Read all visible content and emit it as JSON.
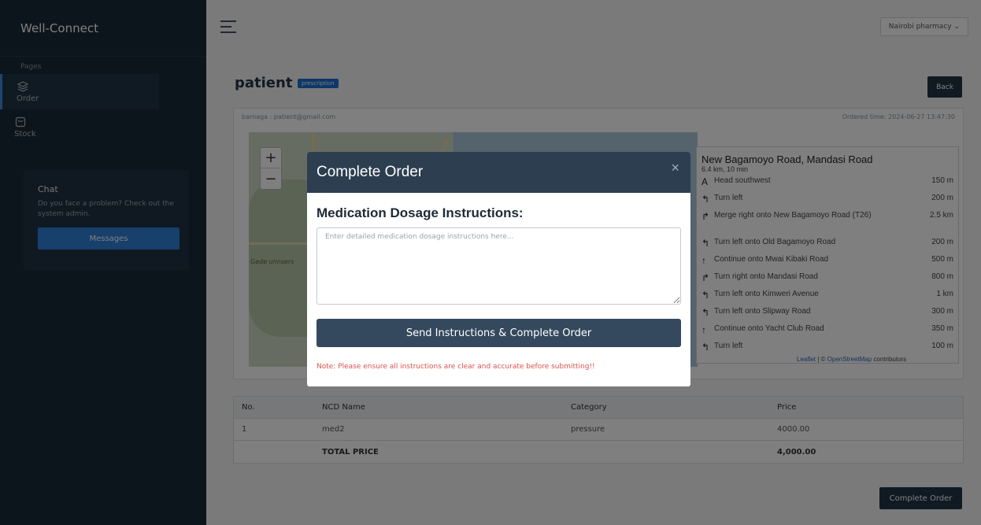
{
  "app": {
    "brand": "Well-Connect"
  },
  "sidebar": {
    "section_label": "Pages",
    "items": [
      {
        "label": "Order",
        "icon": "layers-icon",
        "active": true
      },
      {
        "label": "Stock",
        "icon": "box-icon",
        "active": false
      }
    ],
    "chat": {
      "title": "Chat",
      "text": "Do you face a problem? Check out the system admin.",
      "button_label": "Messages"
    }
  },
  "topbar": {
    "pharmacy_select": "Nairobi pharmacy ⌄"
  },
  "order": {
    "title": "patient",
    "badge": "prescription",
    "back_label": "Back",
    "user_email": "barnaga : patient@gmail.com",
    "ordered_time": "Ordered time: 2024-06-27 13:47:30"
  },
  "map": {
    "zoom_in": "+",
    "zoom_out": "−",
    "place_label": "Gede unnsers",
    "routing": {
      "title": "New Bagamoyo Road, Mandasi Road",
      "summary": "6.4 km, 10 min",
      "steps": [
        {
          "arrow": "A",
          "text": "Head southwest",
          "dist": "150 m"
        },
        {
          "arrow": "↰",
          "text": "Turn left",
          "dist": "200 m"
        },
        {
          "arrow": "↱",
          "text": "Merge right onto New Bagamoyo Road (T26)",
          "dist": "2.5 km"
        },
        {
          "arrow": "↰",
          "text": "Turn left onto Old Bagamoyo Road",
          "dist": "200 m"
        },
        {
          "arrow": "↑",
          "text": "Continue onto Mwai Kibaki Road",
          "dist": "500 m"
        },
        {
          "arrow": "↱",
          "text": "Turn right onto Mandasi Road",
          "dist": "800 m"
        },
        {
          "arrow": "↰",
          "text": "Turn left onto Kimweri Avenue",
          "dist": "1 km"
        },
        {
          "arrow": "↰",
          "text": "Turn left onto Slipway Road",
          "dist": "300 m"
        },
        {
          "arrow": "↑",
          "text": "Continue onto Yacht Club Road",
          "dist": "350 m"
        },
        {
          "arrow": "↰",
          "text": "Turn left",
          "dist": "100 m"
        }
      ]
    },
    "attribution_leaflet": "Leaflet",
    "attribution_sep": " | © ",
    "attribution_osm": "OpenStreetMap",
    "attribution_rest": " contributors"
  },
  "table": {
    "headers": [
      "No.",
      "NCD Name",
      "Category",
      "Price"
    ],
    "rows": [
      [
        "1",
        "med2",
        "pressure",
        "4000.00"
      ]
    ],
    "total_label": "TOTAL PRICE",
    "total_value": "4,000.00"
  },
  "complete_order_label": "Complete Order",
  "modal": {
    "title": "Complete Order",
    "close": "×",
    "label": "Medication Dosage Instructions:",
    "placeholder": "Enter detailed medication dosage instructions here...",
    "send_label": "Send Instructions & Complete Order",
    "note": "Note: Please ensure all instructions are clear and accurate before submitting!!"
  },
  "colors": {
    "sidebar_bg": "#1a2a38",
    "modal_header": "#2c3e50",
    "send_button": "#34495e",
    "accent_blue": "#2f80d8",
    "note_red": "#d9534f"
  }
}
